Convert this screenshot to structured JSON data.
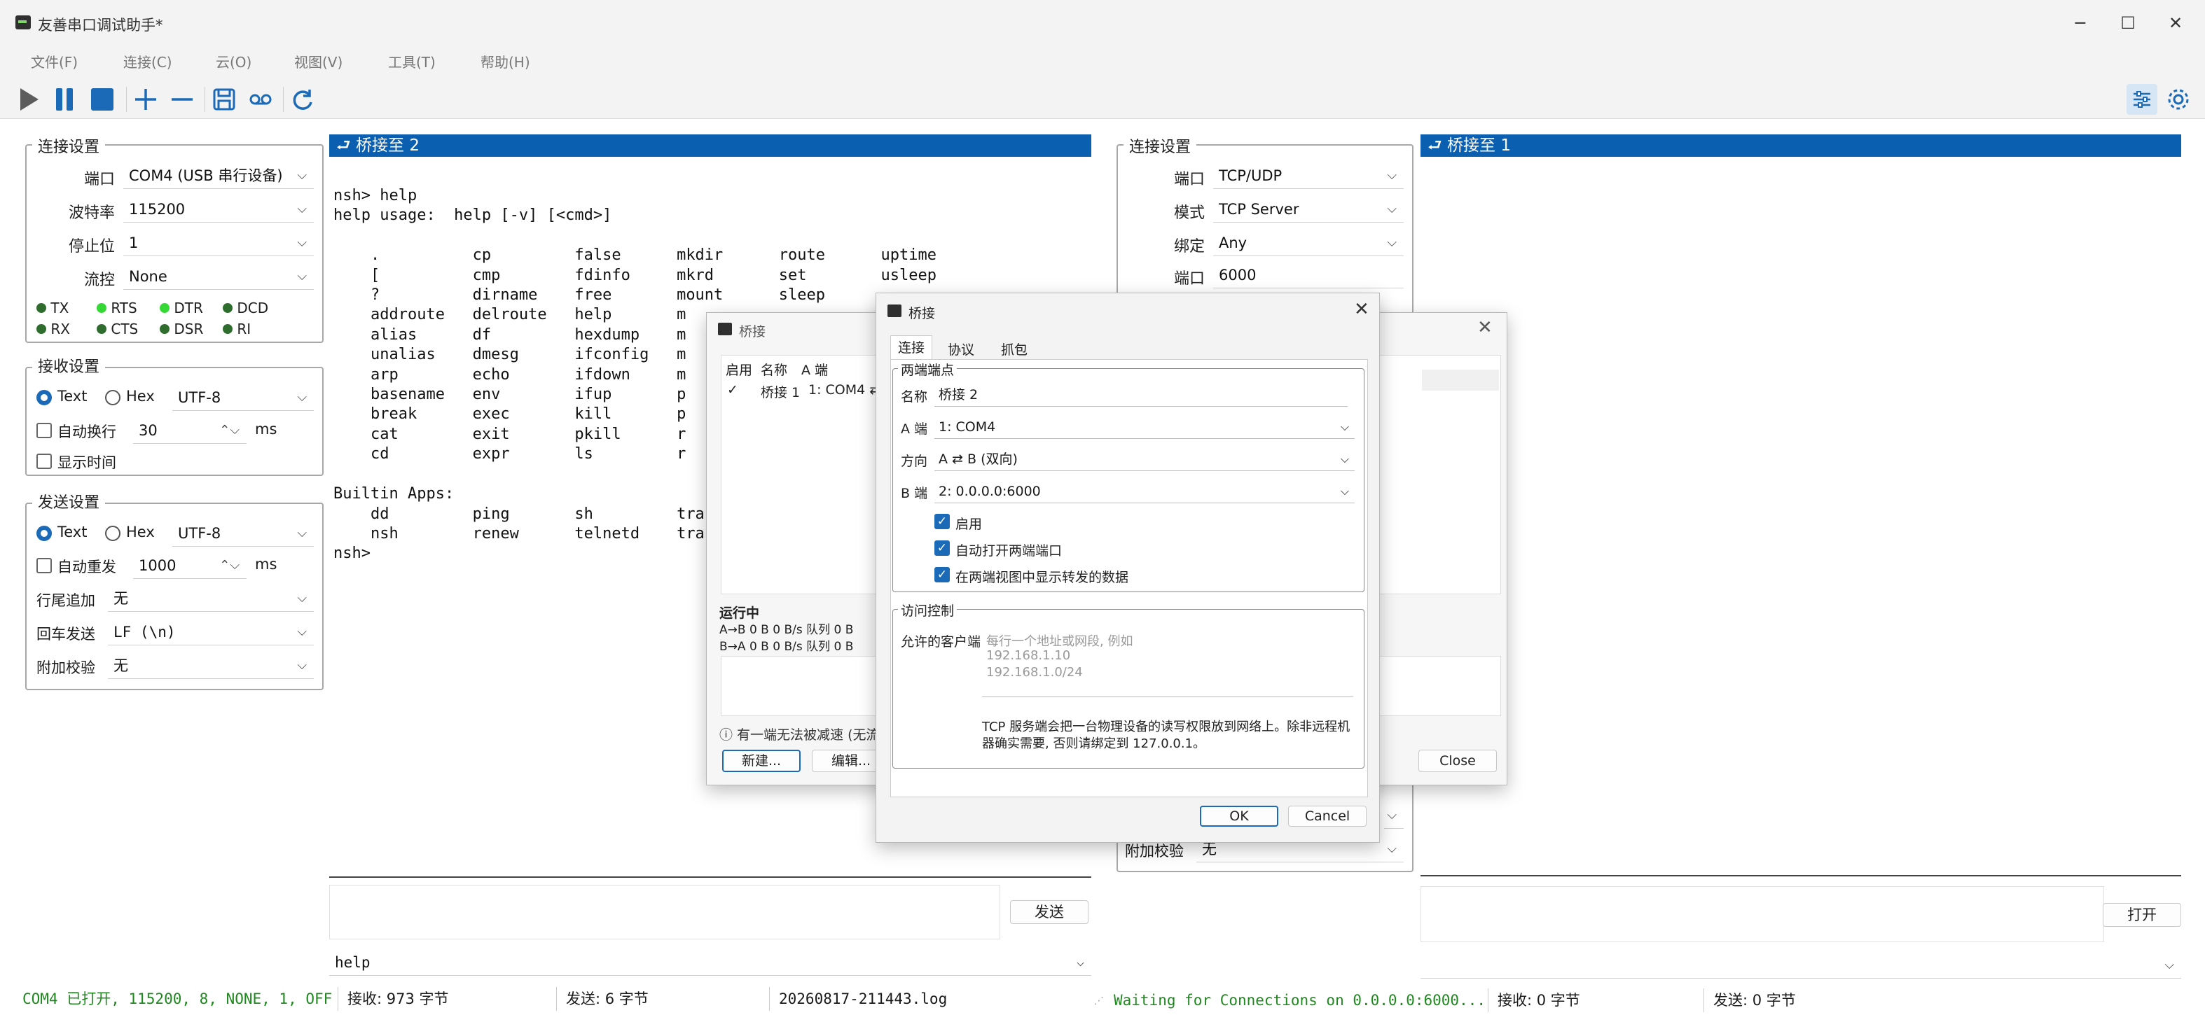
{
  "window": {
    "title": "友善串口调试助手*"
  },
  "menu": [
    "文件(F)",
    "连接(C)",
    "云(O)",
    "视图(V)",
    "工具(T)",
    "帮助(H)"
  ],
  "left": {
    "conn": {
      "title": "连接设置",
      "port_label": "端口",
      "port": "COM4 (USB 串行设备)",
      "baud_label": "波特率",
      "baud": "115200",
      "stop_label": "停止位",
      "stop": "1",
      "flow_label": "流控",
      "flow": "None",
      "signals": [
        "TX",
        "RTS",
        "DTR",
        "DCD",
        "RX",
        "CTS",
        "DSR",
        "RI"
      ]
    },
    "recv": {
      "title": "接收设置",
      "text": "Text",
      "hex": "Hex",
      "enc": "UTF-8",
      "wrap": "自动换行",
      "wrap_val": "30",
      "ms": "ms",
      "show_time": "显示时间"
    },
    "send": {
      "title": "发送设置",
      "text": "Text",
      "hex": "Hex",
      "enc": "UTF-8",
      "repeat": "自动重发",
      "repeat_val": "1000",
      "ms": "ms",
      "tail_label": "行尾追加",
      "tail": "无",
      "enter_label": "回车发送",
      "enter": "LF (\\n)",
      "check_label": "附加校验",
      "check": "无"
    },
    "bridge_header": "⮐ 桥接至 2",
    "terminal": "nsh> help\nhelp usage:  help [-v] [<cmd>]\n\n    .          cp         false      mkdir      route      uptime\n    [          cmp        fdinfo     mkrd       set        usleep\n    ?          dirname    free       mount      sleep\n    addroute   delroute   help       m\n    alias      df         hexdump    m\n    unalias    dmesg      ifconfig   m\n    arp        echo       ifdown     m\n    basename   env        ifup       p\n    break      exec       kill       p\n    cat        exit       pkill      r\n    cd         expr       ls         r\n\nBuiltin Apps:\n    dd         ping       sh         tra\n    nsh        renew      telnetd    tra\nnsh>",
    "send_button": "发送",
    "history": "help",
    "status": {
      "state": "COM4 已打开, 115200, 8, NONE, 1, OFF",
      "recv": "接收: 973 字节",
      "sent": "发送: 6 字节",
      "log": "20260817-211443.log"
    }
  },
  "right": {
    "conn": {
      "title": "连接设置",
      "port_label": "端口",
      "port": "TCP/UDP",
      "mode_label": "模式",
      "mode": "TCP Server",
      "bind_label": "绑定",
      "bind": "Any",
      "num_label": "端口",
      "num": "6000",
      "check_label": "附加校验",
      "check": "无"
    },
    "bridge_header": "⮐ 桥接至 1",
    "open_button": "打开",
    "status": {
      "state": "Waiting for Connections on 0.0.0.0:6000...",
      "recv": "接收: 0 字节",
      "sent": "发送: 0 字节"
    }
  },
  "bridge_list": {
    "title": "桥接",
    "cols": [
      "启用",
      "名称",
      "A 端"
    ],
    "row": {
      "check": "✓",
      "name": "桥接 1",
      "a": "1: COM4 ⇄"
    },
    "running": "运行中",
    "ab": "A→B  0 B   0 B/s  队列 0 B",
    "ba": "B→A  0 B   0 B/s  队列 0 B",
    "note": "ⓘ 有一端无法被减速 (无流",
    "new": "新建...",
    "edit": "编辑...",
    "close": "Close"
  },
  "bridge_edit": {
    "title": "桥接",
    "tabs": [
      "连接",
      "协议",
      "抓包"
    ],
    "endpoints_title": "两端端点",
    "name_label": "名称",
    "name": "桥接 2",
    "a_label": "A 端",
    "a": "1: COM4",
    "dir_label": "方向",
    "dir": "A ⇄ B (双向)",
    "b_label": "B 端",
    "b": "2: 0.0.0.0:6000",
    "enable": "启用",
    "auto_open": "自动打开两端端口",
    "show_data": "在两端视图中显示转发的数据",
    "access_title": "访问控制",
    "clients_label": "允许的客户端",
    "placeholder1": "每行一个地址或网段, 例如",
    "placeholder2": "192.168.1.10",
    "placeholder3": "192.168.1.0/24",
    "hint1": "TCP 服务端会把一台物理设备的读写权限放到网络上。除非远程机",
    "hint2": "器确实需要, 否则请绑定到 127.0.0.1。",
    "ok": "OK",
    "cancel": "Cancel"
  },
  "colors": {
    "accent": "#1a6ab8",
    "bridge_bar": "#0b5fb0",
    "status_green": "#1e8a1e"
  }
}
